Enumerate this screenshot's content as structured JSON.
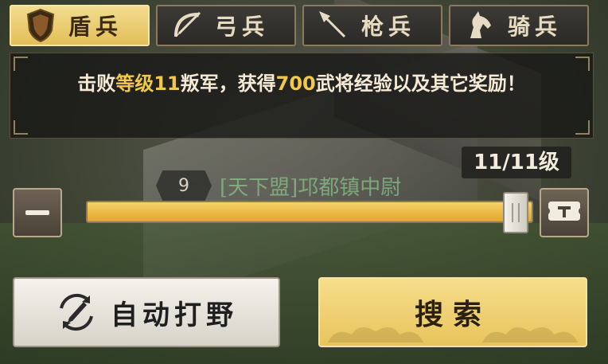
{
  "tabs": [
    {
      "label": "盾兵",
      "icon": "shield-icon",
      "active": true
    },
    {
      "label": "弓兵",
      "icon": "bow-icon",
      "active": false
    },
    {
      "label": "枪兵",
      "icon": "spear-icon",
      "active": false
    },
    {
      "label": "骑兵",
      "icon": "horse-icon",
      "active": false
    }
  ],
  "info": {
    "pre": "击败",
    "level_text": "等级11",
    "mid": "叛军，获得",
    "exp_amount": "700",
    "post": "武将经验以及其它奖励！"
  },
  "level_label": "11/11级",
  "world_overlay": {
    "badge": "9",
    "name": "[天下盟]邛都镇中尉"
  },
  "slider": {
    "value": 11,
    "max": 11
  },
  "buttons": {
    "auto": "自动打野",
    "search": "搜索"
  },
  "colors": {
    "accent_gold": "#f2c84b",
    "tab_active": "#e8c45c",
    "fill": "#e2a52a"
  }
}
